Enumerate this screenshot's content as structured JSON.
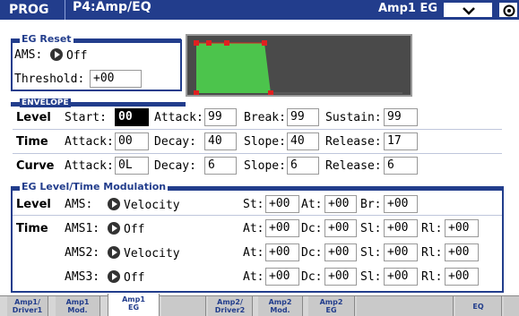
{
  "header": {
    "mode": "PROG",
    "page": "P4:Amp/EQ",
    "menu": "Amp1 EG"
  },
  "eg_reset": {
    "title": "EG Reset",
    "ams_label": "AMS:",
    "ams_value": "Off",
    "threshold_label": "Threshold:",
    "threshold_value": "+00"
  },
  "envelope": {
    "title": "ENVELOPE",
    "level": {
      "row_label": "Level",
      "start_label": "Start:",
      "start_value": "00",
      "attack_label": "Attack:",
      "attack_value": "99",
      "break_label": "Break:",
      "break_value": "99",
      "sustain_label": "Sustain:",
      "sustain_value": "99"
    },
    "time": {
      "row_label": "Time",
      "attack_label": "Attack:",
      "attack_value": "00",
      "decay_label": "Decay:",
      "decay_value": "40",
      "slope_label": "Slope:",
      "slope_value": "40",
      "release_label": "Release:",
      "release_value": "17"
    },
    "curve": {
      "row_label": "Curve",
      "attack_label": "Attack:",
      "attack_value": "0L",
      "decay_label": "Decay:",
      "decay_value": "6",
      "slope_label": "Slope:",
      "slope_value": "6",
      "release_label": "Release:",
      "release_value": "6"
    }
  },
  "modulation": {
    "title": "EG Level/Time Modulation",
    "level": {
      "row_label": "Level",
      "ams_label": "AMS:",
      "ams_value": "Velocity",
      "st_label": "St:",
      "st_value": "+00",
      "at_label": "At:",
      "at_value": "+00",
      "br_label": "Br:",
      "br_value": "+00"
    },
    "time": {
      "row_label": "Time",
      "rows": [
        {
          "ams_label": "AMS1:",
          "ams_value": "Off",
          "at": "+00",
          "dc": "+00",
          "sl": "+00",
          "rl": "+00"
        },
        {
          "ams_label": "AMS2:",
          "ams_value": "Velocity",
          "at": "+00",
          "dc": "+00",
          "sl": "+00",
          "rl": "+00"
        },
        {
          "ams_label": "AMS3:",
          "ams_value": "Off",
          "at": "+00",
          "dc": "+00",
          "sl": "+00",
          "rl": "+00"
        }
      ],
      "at_label": "At:",
      "dc_label": "Dc:",
      "sl_label": "Sl:",
      "rl_label": "Rl:"
    }
  },
  "tabs": [
    "Amp1/\nDriver1",
    "Amp1\nMod.",
    "Amp1\nEG",
    "",
    "Amp2/\nDriver2",
    "Amp2\nMod.",
    "Amp2\nEG",
    "",
    "EQ",
    ""
  ],
  "colors": {
    "header_bg": "#223d8c",
    "graph_fill": "#4cc44c",
    "graph_point": "#e02020"
  },
  "icons": {
    "dropdown": "chevron-down-icon",
    "settings": "gear-icon",
    "popup": "popup-arrow-icon"
  }
}
